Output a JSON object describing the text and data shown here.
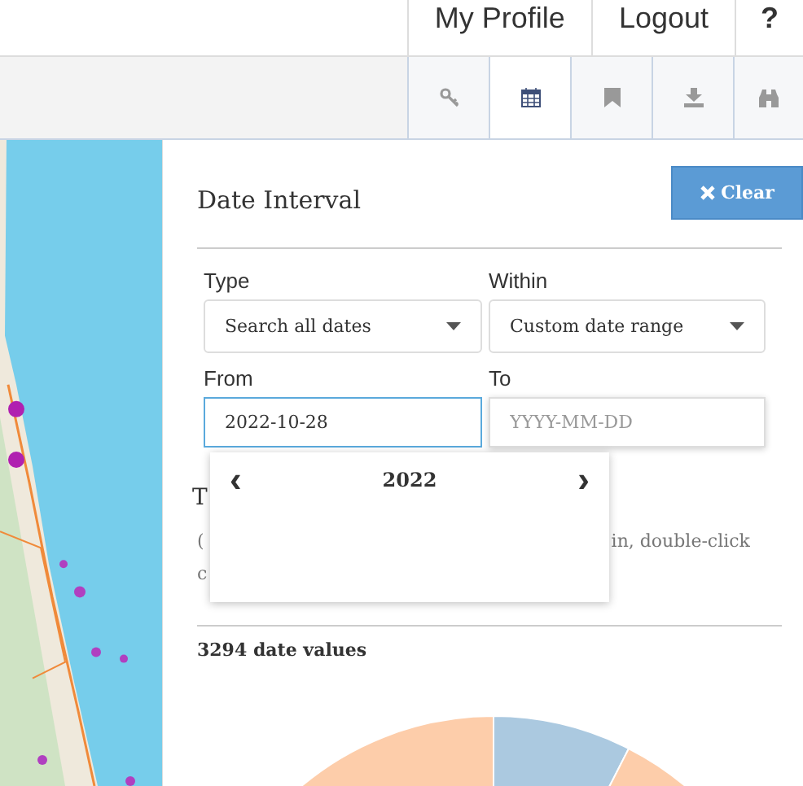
{
  "top_nav": [
    {
      "label": "My Profile"
    },
    {
      "label": "Logout"
    },
    {
      "label": "?"
    }
  ],
  "toolbar": [
    {
      "kind": "key",
      "selected": false
    },
    {
      "kind": "calendar",
      "selected": true
    },
    {
      "kind": "bookmark",
      "selected": false
    },
    {
      "kind": "download",
      "selected": false
    },
    {
      "kind": "binoculars",
      "selected": false
    }
  ],
  "panel": {
    "title": "Date Interval",
    "clear_button": "Clear",
    "fields": [
      {
        "label": "Type",
        "kind": "select",
        "value": "Search all dates"
      },
      {
        "label": "Within",
        "kind": "select",
        "value": "Custom date range"
      },
      {
        "label": "From",
        "kind": "input",
        "value": "2022-10-28",
        "focused": true
      },
      {
        "label": "To",
        "kind": "input",
        "placeholder": "YYYY-MM-DD",
        "focused": false
      }
    ],
    "hidden_heading": "T",
    "note_fragments": [
      "(",
      "in, double-click",
      "c"
    ],
    "datepicker": {
      "prev": "‹",
      "year": "2022",
      "next": "›"
    },
    "count": "3294 date values"
  }
}
